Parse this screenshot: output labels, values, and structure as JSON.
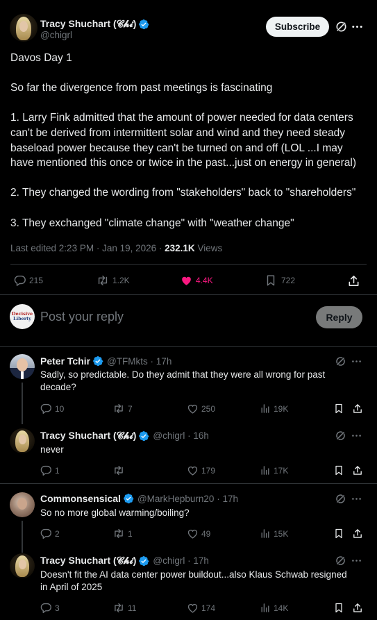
{
  "post": {
    "author_name": "Tracy Shuchart (𝓒𝓱𝓲)",
    "author_handle": "@chigrl",
    "subscribe_label": "Subscribe",
    "lines": [
      "Davos Day 1",
      "",
      "So far the divergence from past meetings is fascinating",
      "",
      "1. Larry Fink admitted that the amount of power needed for data centers",
      "can't be derived from intermittent solar and wind and they need steady",
      "baseload power because they can't be turned on and off (LOL ...I may",
      "have mentioned this once or twice in the past...just on energy in general)",
      "",
      "2. They changed the wording from \"stakeholders\" back to \"shareholders\"",
      "",
      "3. They exchanged \"climate change\" with \"weather change\""
    ],
    "edited": "Last edited 2:23 PM · Jan 19, 2026 · ",
    "views_count": "232.1K",
    "views_label": " Views",
    "stats": {
      "replies": "215",
      "reposts": "1.2K",
      "likes": "4.4K",
      "bookmarks": "722"
    }
  },
  "compose": {
    "placeholder": "Post your reply",
    "reply_label": "Reply",
    "avatar_text_1": "Decisive",
    "avatar_text_2": "Liberty"
  },
  "replies": [
    {
      "name": "Peter Tchir",
      "handle": "@TFMkts · 17h",
      "text": [
        "Sadly, so predictable.  Do they admit that they were all wrong for past",
        "decade?"
      ],
      "stats": {
        "replies": "10",
        "reposts": "7",
        "likes": "250",
        "views": "19K"
      }
    },
    {
      "name": "Tracy Shuchart (𝓒𝓱𝓲)",
      "handle": "@chigrl · 16h",
      "text": [
        "never"
      ],
      "stats": {
        "replies": "1",
        "reposts": "",
        "likes": "179",
        "views": "17K"
      }
    },
    {
      "name": "Commonsensical",
      "handle": "@MarkHepburn20 · 17h",
      "text": [
        "So no more global warming/boiling?"
      ],
      "stats": {
        "replies": "2",
        "reposts": "1",
        "likes": "49",
        "views": "15K"
      }
    },
    {
      "name": "Tracy Shuchart (𝓒𝓱𝓲)",
      "handle": "@chigrl · 17h",
      "text": [
        "Doesn't fit the AI data center power buildout...also Klaus Schwab resigned",
        "in April of 2025"
      ],
      "stats": {
        "replies": "3",
        "reposts": "11",
        "likes": "174",
        "views": "14K"
      }
    }
  ],
  "colors": {
    "background": "#000000",
    "text": "#e7e9ea",
    "muted": "#71767b",
    "verified": "#1d9bf0",
    "like_active": "#f91880",
    "divider": "#2f3336"
  },
  "icons": [
    "verified-badge-icon",
    "grok-icon",
    "more-icon",
    "reply-icon",
    "repost-icon",
    "like-icon",
    "bookmark-icon",
    "share-icon",
    "views-icon"
  ]
}
